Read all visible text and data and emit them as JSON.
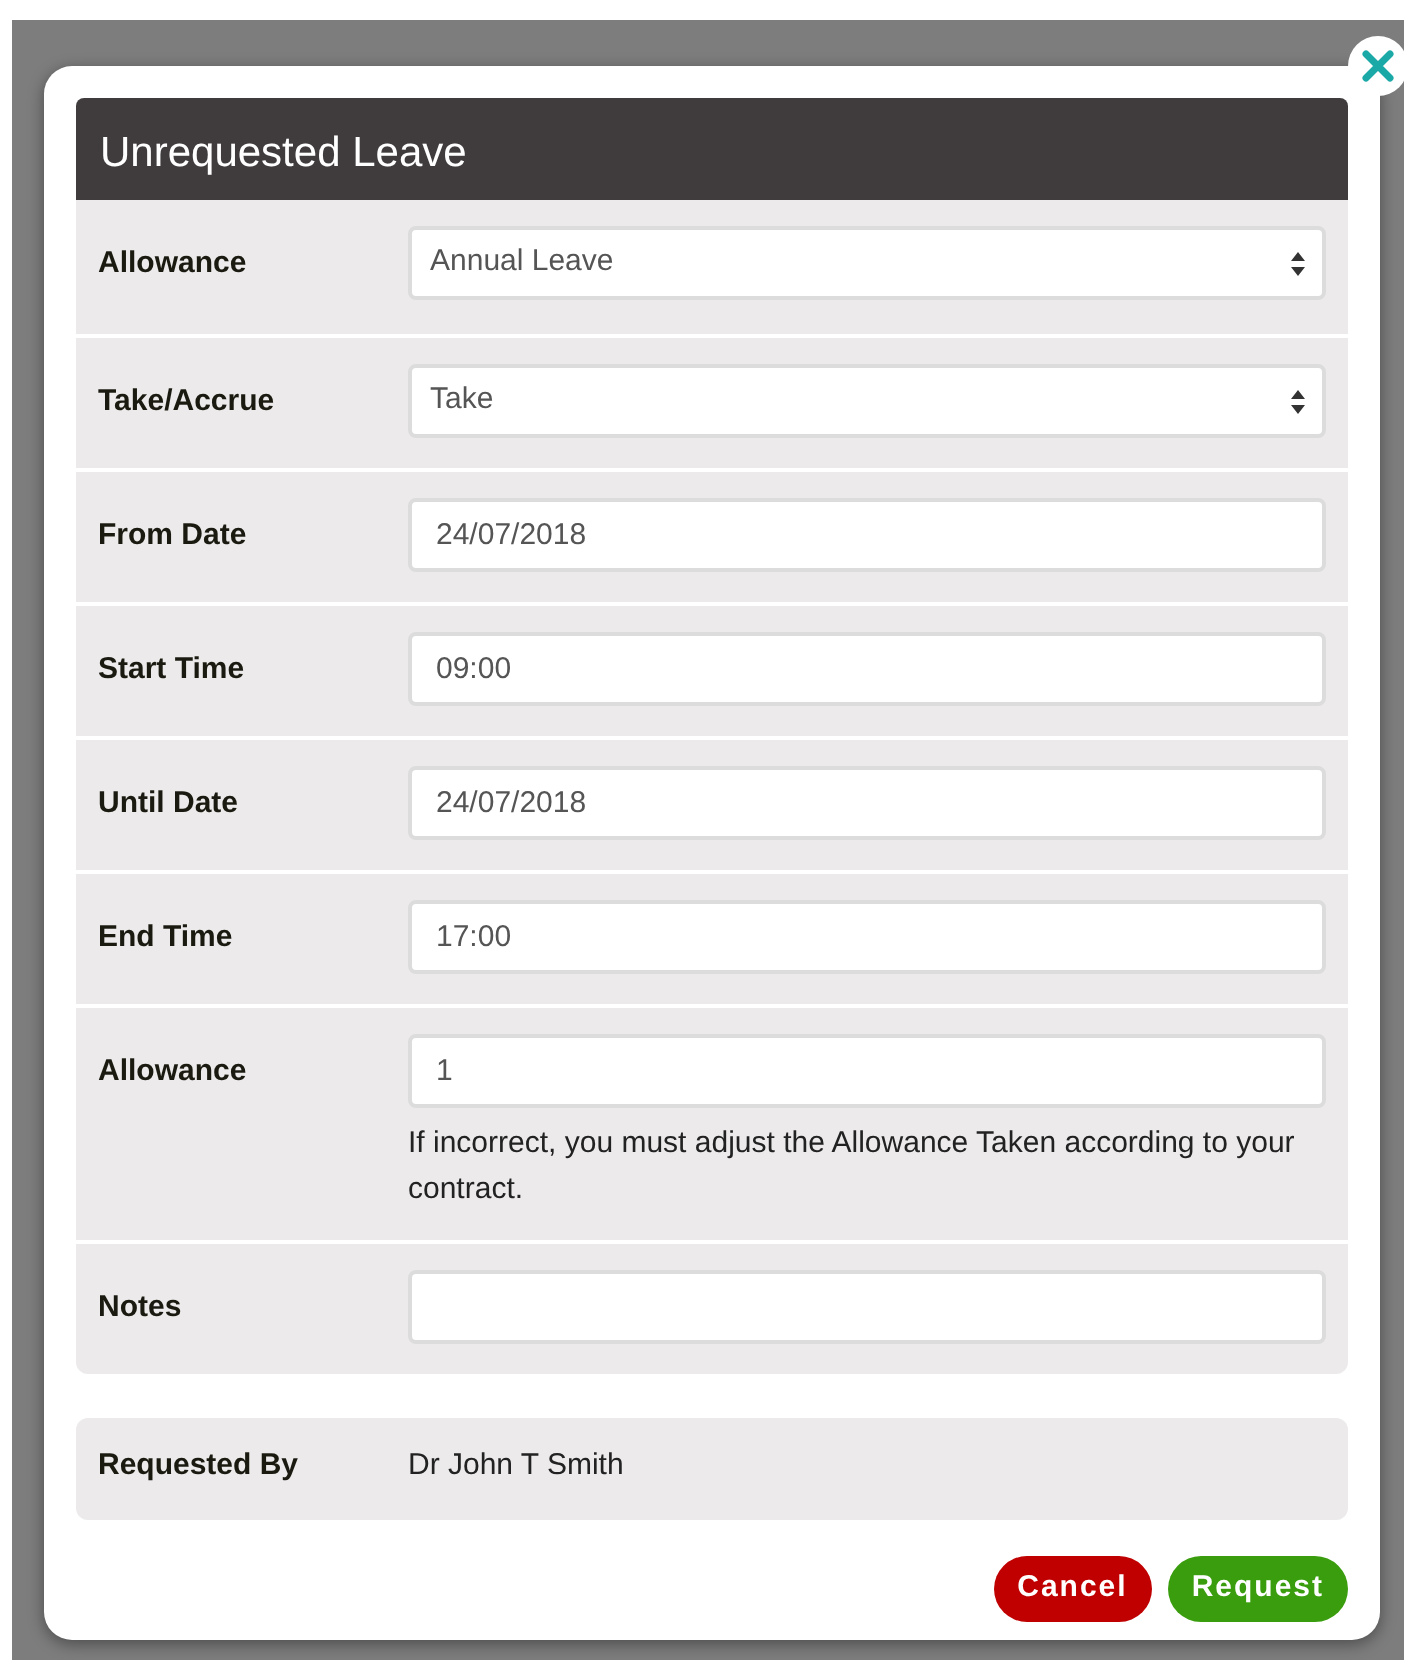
{
  "dialog": {
    "title": "Unrequested Leave",
    "fields": [
      {
        "label": "Allowance",
        "kind": "select",
        "value": "Annual Leave"
      },
      {
        "label": "Take/Accrue",
        "kind": "select",
        "value": "Take"
      },
      {
        "label": "From Date",
        "kind": "input",
        "value": "24/07/2018"
      },
      {
        "label": "Start Time",
        "kind": "input",
        "value": "09:00"
      },
      {
        "label": "Until Date",
        "kind": "input",
        "value": "24/07/2018"
      },
      {
        "label": "End Time",
        "kind": "input",
        "value": "17:00"
      },
      {
        "label": "Allowance",
        "kind": "input",
        "value": "1",
        "help": "If incorrect, you must adjust the Allowance Taken according to your contract."
      },
      {
        "label": "Notes",
        "kind": "input"
      }
    ],
    "requested_by": {
      "label": "Requested By",
      "value": "Dr John T Smith"
    },
    "buttons": [
      {
        "label": "Cancel",
        "kind": "danger"
      },
      {
        "label": "Request",
        "kind": "success"
      }
    ]
  }
}
